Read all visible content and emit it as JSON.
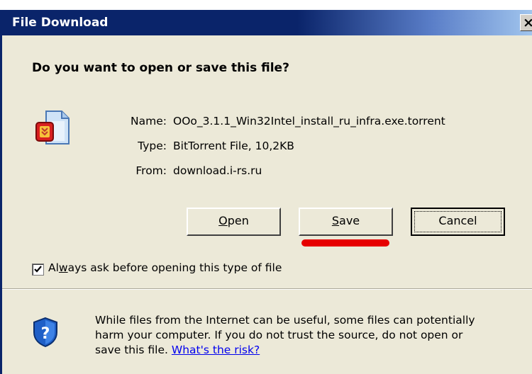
{
  "window": {
    "title": "File Download"
  },
  "dialog": {
    "question": "Do you want to open or save this file?",
    "file": {
      "name_label": "Name:",
      "name_value": "OOo_3.1.1_Win32Intel_install_ru_infra.exe.torrent",
      "type_label": "Type:",
      "type_value": "BitTorrent File, 10,2KB",
      "from_label": "From:",
      "from_value": "download.i-rs.ru"
    },
    "buttons": {
      "open": {
        "accel": "O",
        "rest": "pen"
      },
      "save": {
        "accel": "S",
        "rest": "ave"
      },
      "cancel": "Cancel"
    },
    "checkbox": {
      "checked": true,
      "label_pre": "Al",
      "label_accel": "w",
      "label_post": "ays ask before opening this type of file"
    },
    "warning": {
      "line1": "While files from the Internet can be useful, some files can potentially",
      "line2": "harm your computer. If you do not trust the source, do not open or",
      "line3_prefix": "save this file. ",
      "link": "What's the risk?"
    }
  },
  "icons": {
    "file": "bittorrent-file-icon",
    "shield": "security-shield-question-icon",
    "close": "close-icon",
    "check": "checkmark-icon"
  },
  "colors": {
    "titlebar": "#0a246a",
    "dialog_bg": "#ece9d8",
    "link": "#0000ee",
    "annotation_mark": "#e60000"
  }
}
